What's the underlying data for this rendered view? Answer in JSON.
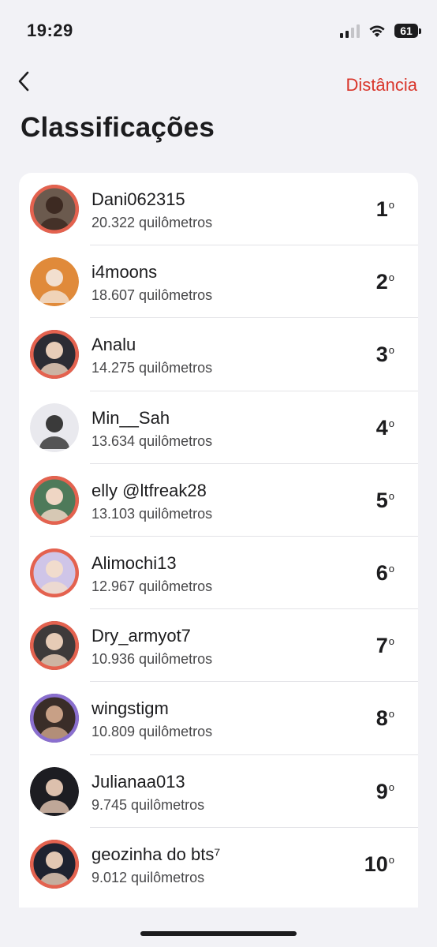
{
  "status": {
    "time": "19:29",
    "battery": "61"
  },
  "nav": {
    "back_icon": "chevron-left-icon",
    "filter_label": "Distância"
  },
  "title": "Classificações",
  "colors": {
    "accent": "#d9362b",
    "badge_ring": "#e4624f"
  },
  "leaderboard": [
    {
      "name": "Dani062315",
      "distance": "20.322 quilômetros",
      "rank": "1",
      "suffix": "o",
      "ring": "#e4624f",
      "bg": "#6b5a4e",
      "face": "#3d2a22"
    },
    {
      "name": "i4moons",
      "distance": "18.607 quilômetros",
      "rank": "2",
      "suffix": "o",
      "ring": "",
      "bg": "#e08a3a",
      "face": "#f2dfcf"
    },
    {
      "name": "Analu",
      "distance": "14.275 quilômetros",
      "rank": "3",
      "suffix": "o",
      "ring": "#e4624f",
      "bg": "#2c2c34",
      "face": "#e8cdb8"
    },
    {
      "name": "Min__Sah",
      "distance": "13.634 quilômetros",
      "rank": "4",
      "suffix": "o",
      "ring": "",
      "bg": "#e9e9ee",
      "face": "#3a3a3a"
    },
    {
      "name": "elly @ltfreak28",
      "distance": "13.103 quilômetros",
      "rank": "5",
      "suffix": "o",
      "ring": "#e4624f",
      "bg": "#4e7a5a",
      "face": "#efd6c4"
    },
    {
      "name": "Alimochi13",
      "distance": "12.967 quilômetros",
      "rank": "6",
      "suffix": "o",
      "ring": "#e4624f",
      "bg": "#cfc5e8",
      "face": "#f1dccd"
    },
    {
      "name": "Dry_armyot7",
      "distance": "10.936 quilômetros",
      "rank": "7",
      "suffix": "o",
      "ring": "#e4624f",
      "bg": "#3e3a3a",
      "face": "#e6cbb6"
    },
    {
      "name": "wingstigm",
      "distance": "10.809 quilômetros",
      "rank": "8",
      "suffix": "o",
      "ring": "#8a6fcf",
      "bg": "#3a2d28",
      "face": "#c8a086"
    },
    {
      "name": "Julianaa013",
      "distance": "9.745 quilômetros",
      "rank": "9",
      "suffix": "o",
      "ring": "",
      "bg": "#1d1d22",
      "face": "#dcc0ad"
    },
    {
      "name": "geozinha do bts⁷",
      "distance": "9.012 quilômetros",
      "rank": "10",
      "suffix": "o",
      "ring": "#e4624f",
      "bg": "#1e2230",
      "face": "#e2c7b3"
    }
  ]
}
